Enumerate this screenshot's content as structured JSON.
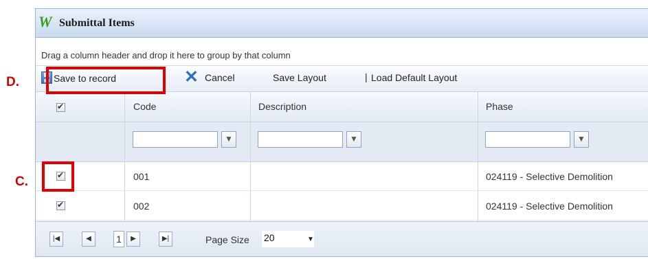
{
  "callouts": {
    "d": "D.",
    "c": "C."
  },
  "window": {
    "logo": "W",
    "title": "Submittal Items"
  },
  "group_panel": {
    "hint": "Drag a column header and drop it here to group by that column"
  },
  "toolbar": {
    "save_to_record": "Save to record",
    "cancel": "Cancel",
    "save_layout": "Save Layout",
    "separator": "|",
    "load_default_layout": "Load Default Layout"
  },
  "columns": {
    "code": "Code",
    "description": "Description",
    "phase": "Phase"
  },
  "filter_icon": "filter-icon",
  "rows": [
    {
      "checked": true,
      "code": "001",
      "description": "",
      "phase": "024119 - Selective Demolition"
    },
    {
      "checked": true,
      "code": "002",
      "description": "",
      "phase": "024119 - Selective Demolition"
    }
  ],
  "pager": {
    "first": "|◀",
    "prev": "◀",
    "current_page": "1",
    "next": "▶",
    "last": "▶|",
    "page_size_label": "Page Size",
    "page_size_value": "20"
  },
  "colors": {
    "highlight": "#e00000",
    "callout": "#d60000",
    "logo": "#3c9a1c",
    "cancel_icon": "#2d6ec1"
  }
}
